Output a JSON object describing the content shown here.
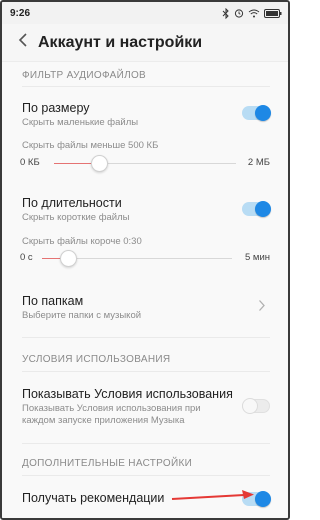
{
  "status_bar": {
    "time": "9:26"
  },
  "header": {
    "title": "Аккаунт и настройки"
  },
  "sections": {
    "audio_filter": "ФИЛЬТР АУДИОФАЙЛОВ",
    "terms": "УСЛОВИЯ ИСПОЛЬЗОВАНИЯ",
    "advanced": "ДОПОЛНИТЕЛЬНЫЕ НАСТРОЙКИ"
  },
  "by_size": {
    "title": "По размеру",
    "subtitle": "Скрыть маленькие файлы",
    "enabled": true,
    "slider_caption": "Скрыть файлы меньше 500 КБ",
    "slider_min": "0 КБ",
    "slider_max": "2 МБ",
    "slider_fraction": 0.25
  },
  "by_duration": {
    "title": "По длительности",
    "subtitle": "Скрыть короткие файлы",
    "enabled": true,
    "slider_caption": "Скрыть файлы короче 0:30",
    "slider_min": "0 с",
    "slider_max": "5 мин",
    "slider_fraction": 0.1
  },
  "by_folders": {
    "title": "По папкам",
    "subtitle": "Выберите папки с музыкой"
  },
  "show_terms": {
    "title": "Показывать Условия использования",
    "subtitle_line1": "Показывать Условия использования при",
    "subtitle_line2": "каждом запуске приложения Музыка",
    "enabled": false
  },
  "recommendations": {
    "title": "Получать рекомендации",
    "enabled": true
  },
  "colors": {
    "accent": "#1e88e5",
    "slider_fill": "#e57373",
    "annotation_arrow": "#e53935"
  },
  "icons": {
    "back": "back-arrow-icon",
    "chevron": "chevron-right-icon",
    "bluetooth": "bluetooth-icon",
    "alarm": "alarm-icon",
    "wifi": "wifi-icon",
    "battery": "battery-icon"
  }
}
